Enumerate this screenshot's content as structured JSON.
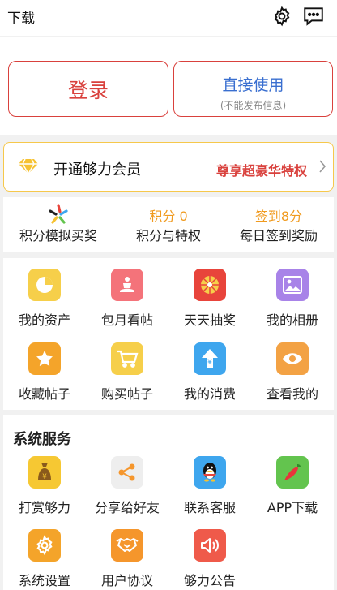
{
  "header": {
    "title": "下载",
    "settings_icon": "gear-icon",
    "message_icon": "chat-icon"
  },
  "login": {
    "login_label": "登录",
    "direct_label": "直接使用",
    "direct_sub": "(不能发布信息)"
  },
  "vip": {
    "label": "开通够力会员",
    "perk": "尊享超豪华特权",
    "diamond_icon": "diamond-icon"
  },
  "points": {
    "simulate": {
      "top_icon": "lottery-star-icon",
      "label": "积分模拟买奖"
    },
    "privileges": {
      "top": "积分 0",
      "label": "积分与特权"
    },
    "checkin": {
      "top": "签到8分",
      "label": "每日签到奖励"
    }
  },
  "features": [
    {
      "label": "我的资产",
      "icon": "pie-chart-icon",
      "color": "#f6cf4a"
    },
    {
      "label": "包月看帖",
      "icon": "meditation-icon",
      "color": "#f4737a"
    },
    {
      "label": "天天抽奖",
      "icon": "wheel-icon",
      "color": "#e8443b"
    },
    {
      "label": "我的相册",
      "icon": "photo-icon",
      "color": "#a883e8"
    },
    {
      "label": "收藏帖子",
      "icon": "star-icon",
      "color": "#f4a42a"
    },
    {
      "label": "购买帖子",
      "icon": "cart-icon",
      "color": "#f6cf4a"
    },
    {
      "label": "我的消费",
      "icon": "yen-arrow-icon",
      "color": "#3ea6ee"
    },
    {
      "label": "查看我的",
      "icon": "eye-icon",
      "color": "#f3a244"
    }
  ],
  "services": {
    "title": "系统服务",
    "items": [
      {
        "label": "打赏够力",
        "icon": "money-bag-icon",
        "color": "#f6c833"
      },
      {
        "label": "分享给好友",
        "icon": "share-icon",
        "color": "#eeeeee"
      },
      {
        "label": "联系客服",
        "icon": "qq-penguin-icon",
        "color": "#3ea6ee"
      },
      {
        "label": "APP下载",
        "icon": "chili-icon",
        "color": "#63c44e"
      },
      {
        "label": "系统设置",
        "icon": "gear-icon",
        "color": "#f4a42a"
      },
      {
        "label": "用户协议",
        "icon": "handshake-icon",
        "color": "#f5962c"
      },
      {
        "label": "够力公告",
        "icon": "speaker-icon",
        "color": "#ef5a4a"
      }
    ]
  }
}
